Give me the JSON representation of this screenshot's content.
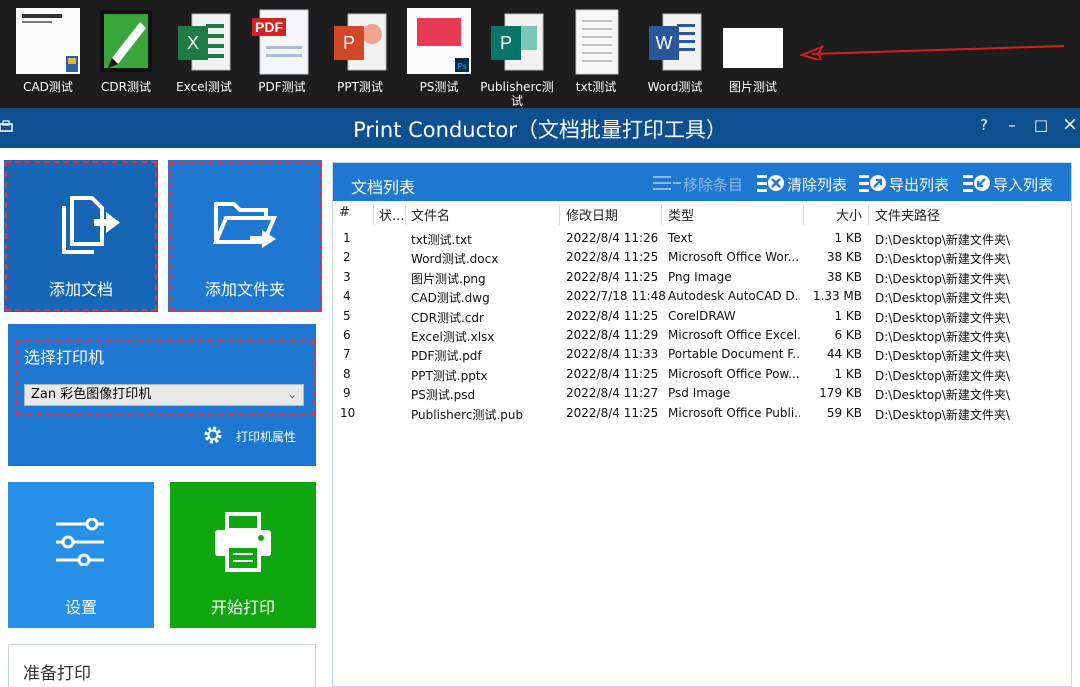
{
  "desktop_files": [
    {
      "label": "CAD测试",
      "icon": "cad-file-icon"
    },
    {
      "label": "CDR测试",
      "icon": "coreldraw-file-icon"
    },
    {
      "label": "Excel测试",
      "icon": "excel-file-icon"
    },
    {
      "label": "PDF测试",
      "icon": "pdf-file-icon",
      "badge": "PDF"
    },
    {
      "label": "PPT测试",
      "icon": "powerpoint-file-icon",
      "badge": "P"
    },
    {
      "label": "PS测试",
      "icon": "photoshop-file-icon",
      "badge": "Ps"
    },
    {
      "label": "Publisherc测试",
      "icon": "publisher-file-icon",
      "badge": "P"
    },
    {
      "label": "txt测试",
      "icon": "text-file-icon"
    },
    {
      "label": "Word测试",
      "icon": "word-file-icon",
      "badge": "W"
    },
    {
      "label": "图片测试",
      "icon": "image-file-icon"
    }
  ],
  "excel_badge": "X",
  "app": {
    "title": "Print Conductor（文档批量打印工具）",
    "help": "?",
    "minimize": "–",
    "maximize": "□",
    "close": "×"
  },
  "actions": {
    "add_docs": "添加文档",
    "add_folder": "添加文件夹",
    "settings": "设置",
    "start_print": "开始打印",
    "status": "准备打印"
  },
  "printer": {
    "title": "选择打印机",
    "selected": "Zan 彩色图像打印机",
    "properties": "打印机属性"
  },
  "doclist": {
    "title": "文档列表",
    "remove": "移除条目",
    "clear": "清除列表",
    "export": "导出列表",
    "import": "导入列表",
    "columns": [
      "#",
      "状...",
      "文件名",
      "修改日期",
      "类型",
      "大小",
      "文件夹路径"
    ],
    "rows": [
      [
        "1",
        "",
        "txt测试.txt",
        "2022/8/4 11:26",
        "Text",
        "1 KB",
        "D:\\Desktop\\新建文件夹\\"
      ],
      [
        "2",
        "",
        "Word测试.docx",
        "2022/8/4 11:25",
        "Microsoft Office Wor...",
        "38 KB",
        "D:\\Desktop\\新建文件夹\\"
      ],
      [
        "3",
        "",
        "图片测试.png",
        "2022/8/4 11:25",
        "Png Image",
        "38 KB",
        "D:\\Desktop\\新建文件夹\\"
      ],
      [
        "4",
        "",
        "CAD测试.dwg",
        "2022/7/18 11:48",
        "Autodesk AutoCAD D...",
        "1.33 MB",
        "D:\\Desktop\\新建文件夹\\"
      ],
      [
        "5",
        "",
        "CDR测试.cdr",
        "2022/8/4 11:25",
        "CorelDRAW",
        "1 KB",
        "D:\\Desktop\\新建文件夹\\"
      ],
      [
        "6",
        "",
        "Excel测试.xlsx",
        "2022/8/4 11:29",
        "Microsoft Office Excel...",
        "6 KB",
        "D:\\Desktop\\新建文件夹\\"
      ],
      [
        "7",
        "",
        "PDF测试.pdf",
        "2022/8/4 11:33",
        "Portable Document F...",
        "44 KB",
        "D:\\Desktop\\新建文件夹\\"
      ],
      [
        "8",
        "",
        "PPT测试.pptx",
        "2022/8/4 11:25",
        "Microsoft Office Pow...",
        "1 KB",
        "D:\\Desktop\\新建文件夹\\"
      ],
      [
        "9",
        "",
        "PS测试.psd",
        "2022/8/4 11:27",
        "Psd Image",
        "179 KB",
        "D:\\Desktop\\新建文件夹\\"
      ],
      [
        "10",
        "",
        "Publisherc测试.pub",
        "2022/8/4 11:25",
        "Microsoft Office Publi...",
        "59 KB",
        "D:\\Desktop\\新建文件夹\\"
      ]
    ]
  },
  "colors": {
    "titlebar": "#0e4f8f",
    "tile_blue": "#1e78d2",
    "tile_green": "#10a60f",
    "highlight_dash": "#e8303a"
  }
}
